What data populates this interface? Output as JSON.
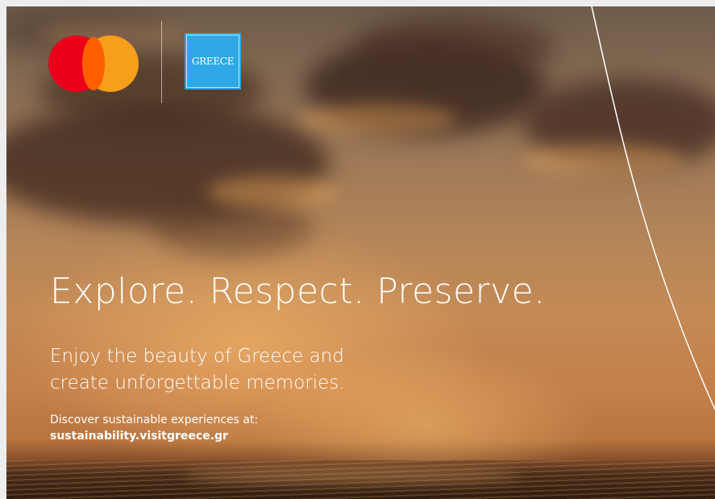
{
  "brand": {
    "mastercard_logo": "mastercard-logo-icon",
    "greece_logo_text": "GREECE",
    "colors": {
      "mastercard_red": "#eb001b",
      "mastercard_yellow": "#f79e1b",
      "mastercard_overlap": "#ff5f00",
      "greece_blue": "#2ea8e6"
    }
  },
  "headline": "Explore. Respect. Preserve.",
  "subheadline": {
    "line1": "Enjoy the beauty of Greece and",
    "line2": "create unforgettable memories."
  },
  "cta": {
    "text": "Discover sustainable experiences at:",
    "url": "sustainability.visitgreece.gr"
  }
}
